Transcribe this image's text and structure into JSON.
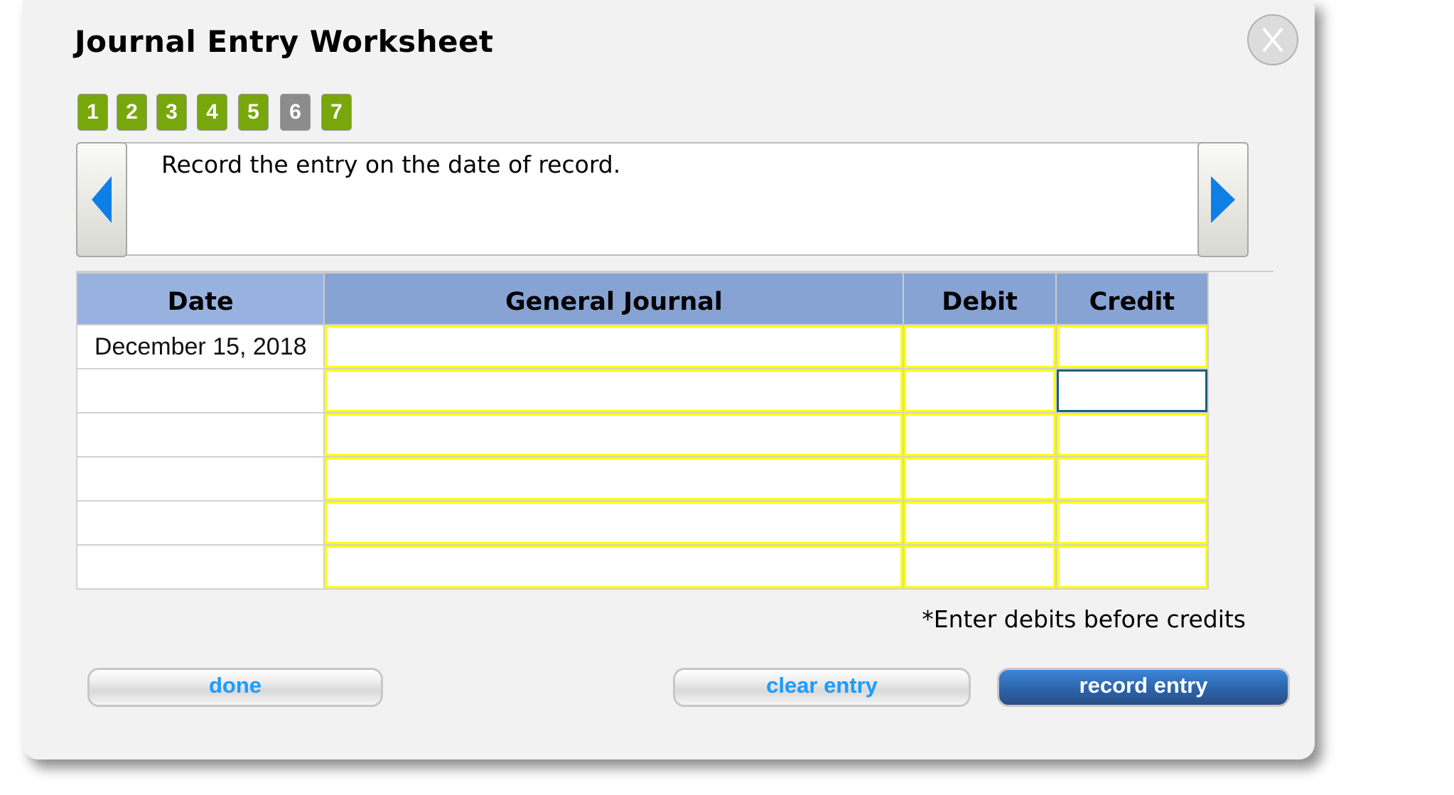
{
  "dialog": {
    "title": "Journal Entry Worksheet",
    "close_icon": "close-x-icon"
  },
  "steps": [
    {
      "label": "1",
      "state": "done"
    },
    {
      "label": "2",
      "state": "done"
    },
    {
      "label": "3",
      "state": "done"
    },
    {
      "label": "4",
      "state": "done"
    },
    {
      "label": "5",
      "state": "done"
    },
    {
      "label": "6",
      "state": "current"
    },
    {
      "label": "7",
      "state": "done"
    }
  ],
  "instruction": {
    "text": "Record the entry on the date of record.",
    "prev_icon": "triangle-left-icon",
    "next_icon": "triangle-right-icon"
  },
  "table": {
    "headers": [
      "Date",
      "General Journal",
      "Debit",
      "Credit"
    ],
    "rows": [
      {
        "date": "December 15, 2018",
        "account": "",
        "debit": "",
        "credit": ""
      },
      {
        "date": "",
        "account": "",
        "debit": "",
        "credit": ""
      },
      {
        "date": "",
        "account": "",
        "debit": "",
        "credit": ""
      },
      {
        "date": "",
        "account": "",
        "debit": "",
        "credit": ""
      },
      {
        "date": "",
        "account": "",
        "debit": "",
        "credit": ""
      },
      {
        "date": "",
        "account": "",
        "debit": "",
        "credit": ""
      }
    ],
    "focused_cell": {
      "row": 1,
      "column": "credit"
    }
  },
  "hint": "*Enter debits before credits",
  "buttons": {
    "done": "done",
    "clear": "clear entry",
    "record": "record entry"
  },
  "colors": {
    "step_done": "#78a70b",
    "step_current": "#8c8c8c",
    "arrow_blue": "#0f7fe6",
    "header_date": "#98b2e0",
    "header_other": "#87a3d4",
    "input_border": "#ffff00",
    "focused_border": "#1e5f7a",
    "link_blue": "#1a9cff"
  }
}
